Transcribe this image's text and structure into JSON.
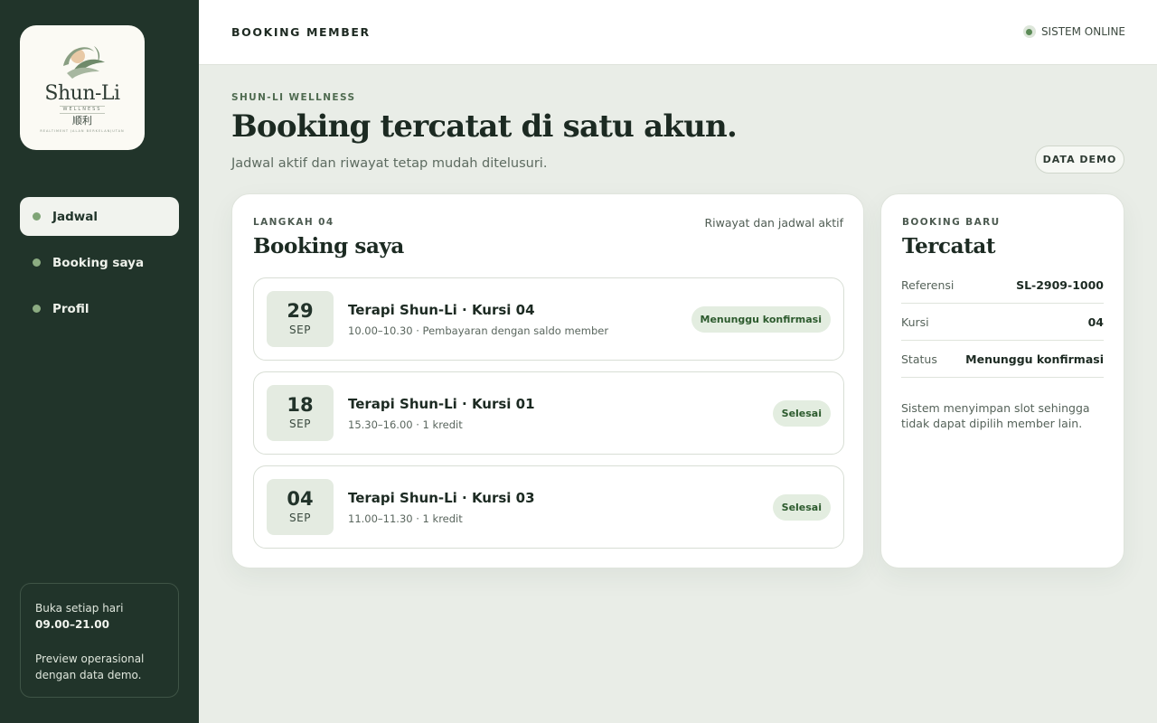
{
  "brand": {
    "name": "Shun-Li",
    "sub": "WELLNESS",
    "chinese": "顺利",
    "tagline": "REALTIMENT JALAN BERKELANJUTAN"
  },
  "sidebar": {
    "items": [
      {
        "label": "Jadwal",
        "active": true
      },
      {
        "label": "Booking saya",
        "active": false
      },
      {
        "label": "Profil",
        "active": false
      }
    ],
    "hours_label": "Buka setiap hari",
    "hours_value": "09.00–21.00",
    "preview_note": "Preview operasional dengan data demo."
  },
  "topbar": {
    "title": "BOOKING MEMBER",
    "status": "SISTEM ONLINE"
  },
  "header": {
    "eyebrow": "SHUN-LI WELLNESS",
    "title": "Booking tercatat di satu akun.",
    "subtitle": "Jadwal aktif dan riwayat tetap mudah ditelusuri.",
    "demo_button": "DATA DEMO"
  },
  "bookings": {
    "step": "LANGKAH 04",
    "title": "Booking saya",
    "filter_note": "Riwayat dan jadwal aktif",
    "items": [
      {
        "day": "29",
        "month": "SEP",
        "title": "Terapi Shun-Li · Kursi 04",
        "detail": "10.00–10.30 · Pembayaran dengan saldo member",
        "status": "Menunggu konfirmasi"
      },
      {
        "day": "18",
        "month": "SEP",
        "title": "Terapi Shun-Li · Kursi 01",
        "detail": "15.30–16.00 · 1 kredit",
        "status": "Selesai"
      },
      {
        "day": "04",
        "month": "SEP",
        "title": "Terapi Shun-Li · Kursi 03",
        "detail": "11.00–11.30 · 1 kredit",
        "status": "Selesai"
      }
    ]
  },
  "new_booking": {
    "eyebrow": "BOOKING BARU",
    "title": "Tercatat",
    "rows": [
      {
        "key": "Referensi",
        "value": "SL-2909-1000"
      },
      {
        "key": "Kursi",
        "value": "04"
      },
      {
        "key": "Status",
        "value": "Menunggu konfirmasi"
      }
    ],
    "note": "Sistem menyimpan slot sehingga tidak dapat dipilih member lain."
  },
  "colors": {
    "sidebar_bg": "#21342a",
    "page_bg": "#e9ede7",
    "accent": "#5b8a56",
    "badge_bg": "#e3ede0"
  }
}
